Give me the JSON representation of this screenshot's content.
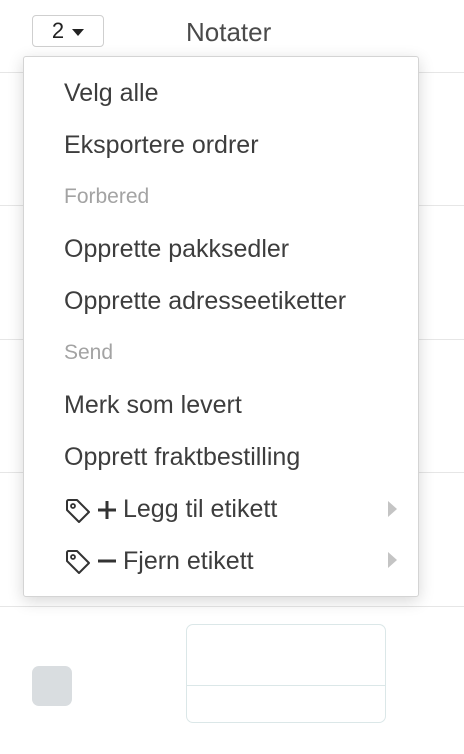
{
  "toolbar": {
    "selected_count": "2",
    "notes_header": "Notater"
  },
  "menu": {
    "select_all": "Velg alle",
    "export_orders": "Eksportere ordrer",
    "section_prepare": "Forbered",
    "create_packing_slips": "Opprette pakksedler",
    "create_address_labels": "Opprette adresseetiketter",
    "section_send": "Send",
    "mark_delivered": "Merk som levert",
    "create_shipping_order": "Opprett fraktbestilling",
    "add_tag": "Legg til etikett",
    "remove_tag": "Fjern etikett"
  },
  "icons": {
    "tag": "tag-outline-icon",
    "plus": "plus-icon",
    "minus": "minus-icon",
    "submenu": "chevron-right-icon",
    "dropdown": "caret-down-icon"
  },
  "colors": {
    "menu_text": "#3d3d3d",
    "section_text": "#a3a3a3",
    "checkbox": "#d9dde0"
  }
}
